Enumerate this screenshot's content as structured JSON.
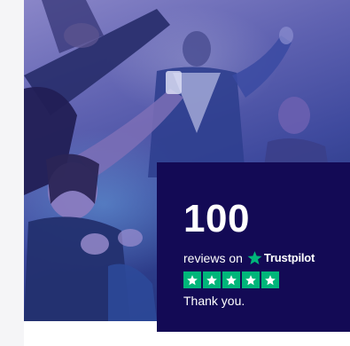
{
  "review": {
    "count": "100",
    "reviews_on": "reviews on",
    "brand": "Trustpilot",
    "rating_stars": 5,
    "thank_you": "Thank you."
  },
  "colors": {
    "card_bg": "#130a55",
    "trustpilot_green": "#00b67a",
    "photo_tint": "#3f4a9e"
  },
  "icons": [
    "trustpilot-star-icon",
    "rating-star-icon"
  ]
}
